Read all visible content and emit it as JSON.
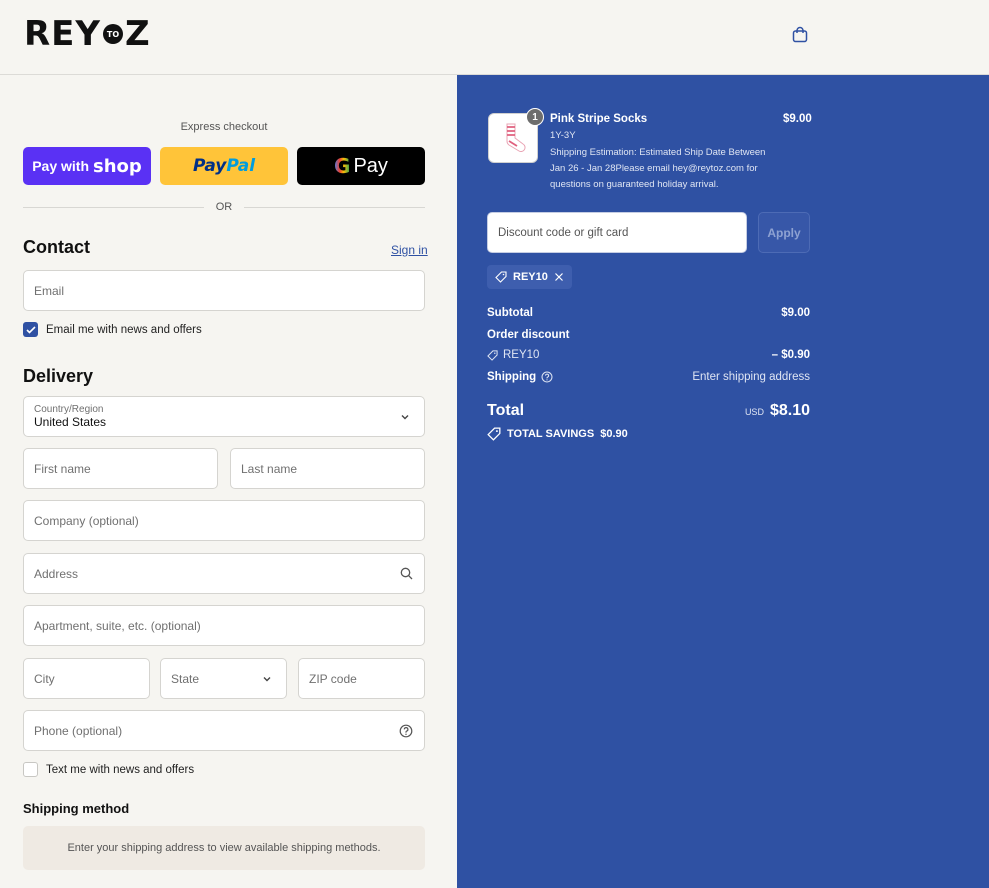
{
  "header": {
    "logo_left": "REY",
    "logo_mid": "TO",
    "logo_right": "Z"
  },
  "express": {
    "label": "Express checkout",
    "shop_pay_prefix": "Pay with",
    "shop_pay_brand": "shop",
    "paypal_a": "Pay",
    "paypal_b": "Pal",
    "gpay_g": "G",
    "gpay_text": "Pay",
    "or": "OR"
  },
  "contact": {
    "title": "Contact",
    "sign_in": "Sign in",
    "email_placeholder": "Email",
    "news_checkbox": "Email me with news and offers"
  },
  "delivery": {
    "title": "Delivery",
    "country_label": "Country/Region",
    "country_value": "United States",
    "first_name": "First name",
    "last_name": "Last name",
    "company": "Company (optional)",
    "address": "Address",
    "apartment": "Apartment, suite, etc. (optional)",
    "city": "City",
    "state": "State",
    "zip": "ZIP code",
    "phone": "Phone (optional)",
    "text_checkbox": "Text me with news and offers"
  },
  "shipping": {
    "title": "Shipping method",
    "message": "Enter your shipping address to view available shipping methods."
  },
  "summary": {
    "product": {
      "quantity": "1",
      "name": "Pink Stripe Socks",
      "variant": "1Y-3Y",
      "note": "Shipping Estimation: Estimated Ship Date Between Jan 26 - Jan 28Please email hey@reytoz.com for questions on guaranteed holiday arrival.",
      "price": "$9.00"
    },
    "discount_placeholder": "Discount code or gift card",
    "apply_label": "Apply",
    "applied_code": "REY10",
    "subtotal_label": "Subtotal",
    "subtotal_value": "$9.00",
    "order_discount_label": "Order discount",
    "discount_code": "REY10",
    "discount_value": "– $0.90",
    "shipping_label": "Shipping",
    "shipping_value": "Enter shipping address",
    "total_label": "Total",
    "currency": "USD",
    "total_value": "$8.10",
    "savings_label": "TOTAL SAVINGS",
    "savings_value": "$0.90"
  },
  "colors": {
    "accent": "#2f51a3",
    "shop_pay": "#5a31f4",
    "paypal": "#ffc439"
  }
}
